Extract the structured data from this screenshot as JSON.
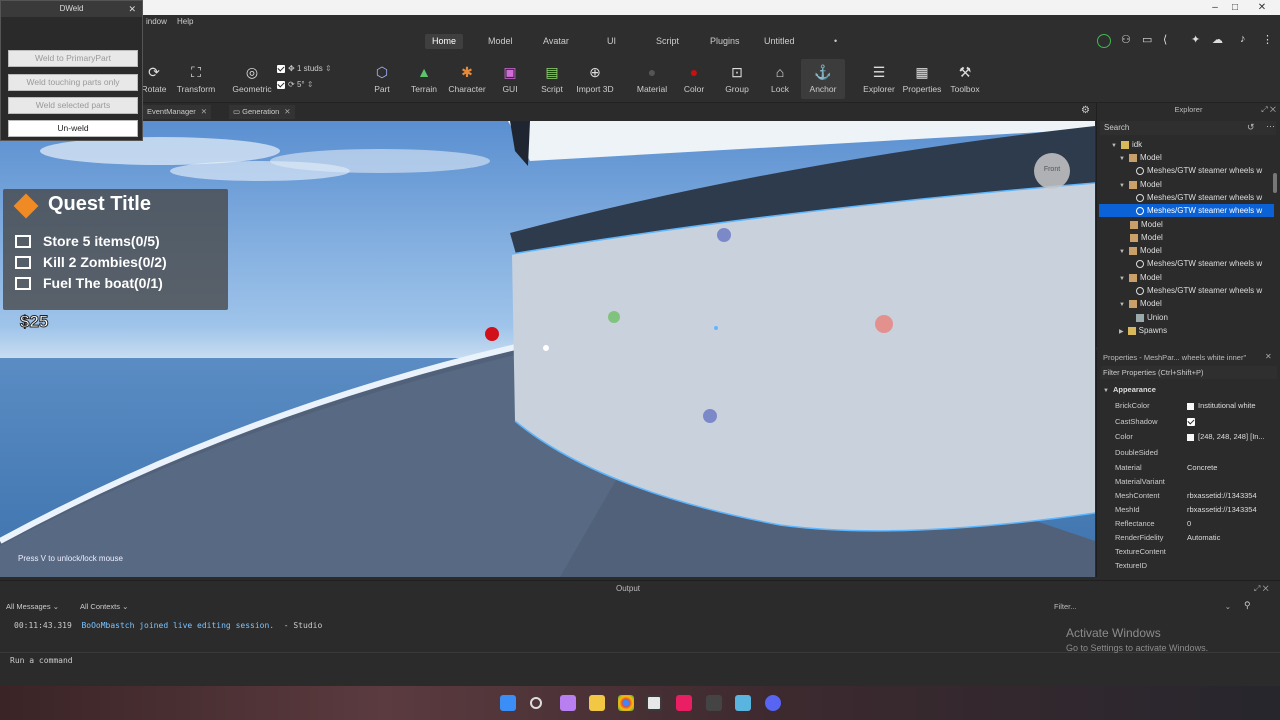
{
  "window": {
    "minimize": "–",
    "maximize": "□",
    "close": "✕"
  },
  "menubar": {
    "items": [
      "indow",
      "Help"
    ]
  },
  "ribbon_tabs": {
    "home": "Home",
    "model": "Model",
    "avatar": "Avatar",
    "ui": "UI",
    "script": "Script",
    "plugins": "Plugins",
    "untitled": "Untitled",
    "dot": "•"
  },
  "tools": {
    "rotate": "Rotate",
    "transform": "Transform",
    "geometric": "Geometric",
    "studs": "1 studs",
    "degrees": "5°",
    "part": "Part",
    "terrain": "Terrain",
    "character": "Character",
    "gui": "GUI",
    "script": "Script",
    "import3d": "Import 3D",
    "material": "Material",
    "color": "Color",
    "group": "Group",
    "lock": "Lock",
    "anchor": "Anchor",
    "explorer": "Explorer",
    "properties": "Properties",
    "toolbox": "Toolbox"
  },
  "doctabs": {
    "eventmanager": "EventManager",
    "generation": "Generation"
  },
  "dweld": {
    "title": "DWeld",
    "weld_primary": "Weld to PrimaryPart",
    "weld_touching": "Weld touching parts only",
    "weld_selected": "Weld selected parts",
    "unweld": "Un-weld"
  },
  "viewport": {
    "quest_title": "Quest Title",
    "quests": [
      "Store 5 items(0/5)",
      "Kill 2 Zombies(0/2)",
      "Fuel The boat(0/1)"
    ],
    "money": "$25",
    "hint": "Press V to unlock/lock mouse",
    "view_cube": "Front"
  },
  "explorer": {
    "title": "Explorer",
    "search": "Search",
    "items": [
      {
        "label": "idk",
        "indent": 0,
        "expanded": true
      },
      {
        "label": "Model",
        "indent": 1,
        "expanded": true
      },
      {
        "label": "Meshes/GTW steamer wheels w",
        "indent": 2
      },
      {
        "label": "Model",
        "indent": 1,
        "expanded": true
      },
      {
        "label": "Meshes/GTW steamer wheels w",
        "indent": 2
      },
      {
        "label": "Meshes/GTW steamer wheels w",
        "indent": 2,
        "selected": true
      },
      {
        "label": "Model",
        "indent": 1
      },
      {
        "label": "Model",
        "indent": 1
      },
      {
        "label": "Model",
        "indent": 1,
        "expanded": true
      },
      {
        "label": "Meshes/GTW steamer wheels w",
        "indent": 2
      },
      {
        "label": "Model",
        "indent": 1,
        "expanded": true
      },
      {
        "label": "Meshes/GTW steamer wheels w",
        "indent": 2
      },
      {
        "label": "Model",
        "indent": 1,
        "expanded": true
      },
      {
        "label": "Union",
        "indent": 2
      },
      {
        "label": "Spawns",
        "indent": 1,
        "collapsed": true
      }
    ]
  },
  "properties": {
    "title": "Properties - MeshPar... wheels white inner\"",
    "filter": "Filter Properties (Ctrl+Shift+P)",
    "section": "Appearance",
    "rows": [
      {
        "name": "BrickColor",
        "value": "Institutional white",
        "swatch": true
      },
      {
        "name": "CastShadow",
        "value": "",
        "check": true
      },
      {
        "name": "Color",
        "value": "[248, 248, 248] [In...",
        "swatch": true
      },
      {
        "name": "DoubleSided",
        "value": ""
      },
      {
        "name": "Material",
        "value": "Concrete"
      },
      {
        "name": "MaterialVariant",
        "value": ""
      },
      {
        "name": "MeshContent",
        "value": "rbxassetid://1343354"
      },
      {
        "name": "MeshId",
        "value": "rbxassetid://1343354"
      },
      {
        "name": "Reflectance",
        "value": "0"
      },
      {
        "name": "RenderFidelity",
        "value": "Automatic"
      },
      {
        "name": "TextureContent",
        "value": ""
      },
      {
        "name": "TextureID",
        "value": ""
      }
    ]
  },
  "output": {
    "title": "Output",
    "all_messages": "All Messages",
    "all_contexts": "All Contexts",
    "filter": "Filter...",
    "log_time": "00:11:43.319",
    "log_msg": "BoOoMbastch joined live editing session.",
    "log_src": "-  Studio",
    "command_placeholder": "Run a command"
  },
  "activate": {
    "line1": "Activate Windows",
    "line2": "Go to Settings to activate Windows."
  },
  "colors": {
    "accent": "#0b62d6",
    "highlight": "#5fb7ff"
  }
}
